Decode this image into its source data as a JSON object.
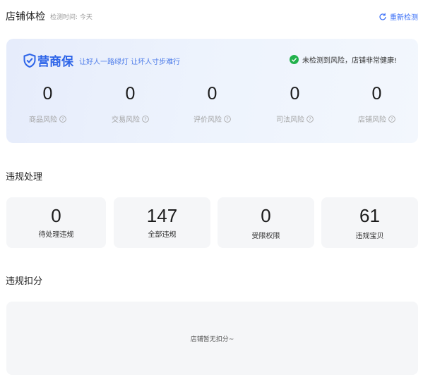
{
  "header": {
    "title": "店铺体检",
    "check_time": "检测时间: 今天",
    "recheck_label": "重新检测"
  },
  "health": {
    "brand_name": "营商保",
    "slogan": "让好人一路绿灯 让坏人寸步难行",
    "status": "未检测到风险，店铺非常健康!",
    "risks": [
      {
        "value": "0",
        "label": "商品风险"
      },
      {
        "value": "0",
        "label": "交易风险"
      },
      {
        "value": "0",
        "label": "评价风险"
      },
      {
        "value": "0",
        "label": "司法风险"
      },
      {
        "value": "0",
        "label": "店铺风险"
      }
    ]
  },
  "violations": {
    "title": "违规处理",
    "cards": [
      {
        "value": "0",
        "label": "待处理违规"
      },
      {
        "value": "147",
        "label": "全部违规"
      },
      {
        "value": "0",
        "label": "受限权限"
      },
      {
        "value": "61",
        "label": "违规宝贝"
      }
    ]
  },
  "deductions": {
    "title": "违规扣分",
    "empty_message": "店铺暂无扣分~"
  },
  "colors": {
    "accent": "#3a6ff7",
    "brand": "#2d64e8",
    "success": "#22b14c",
    "card_bg": "#f5f6f8"
  }
}
